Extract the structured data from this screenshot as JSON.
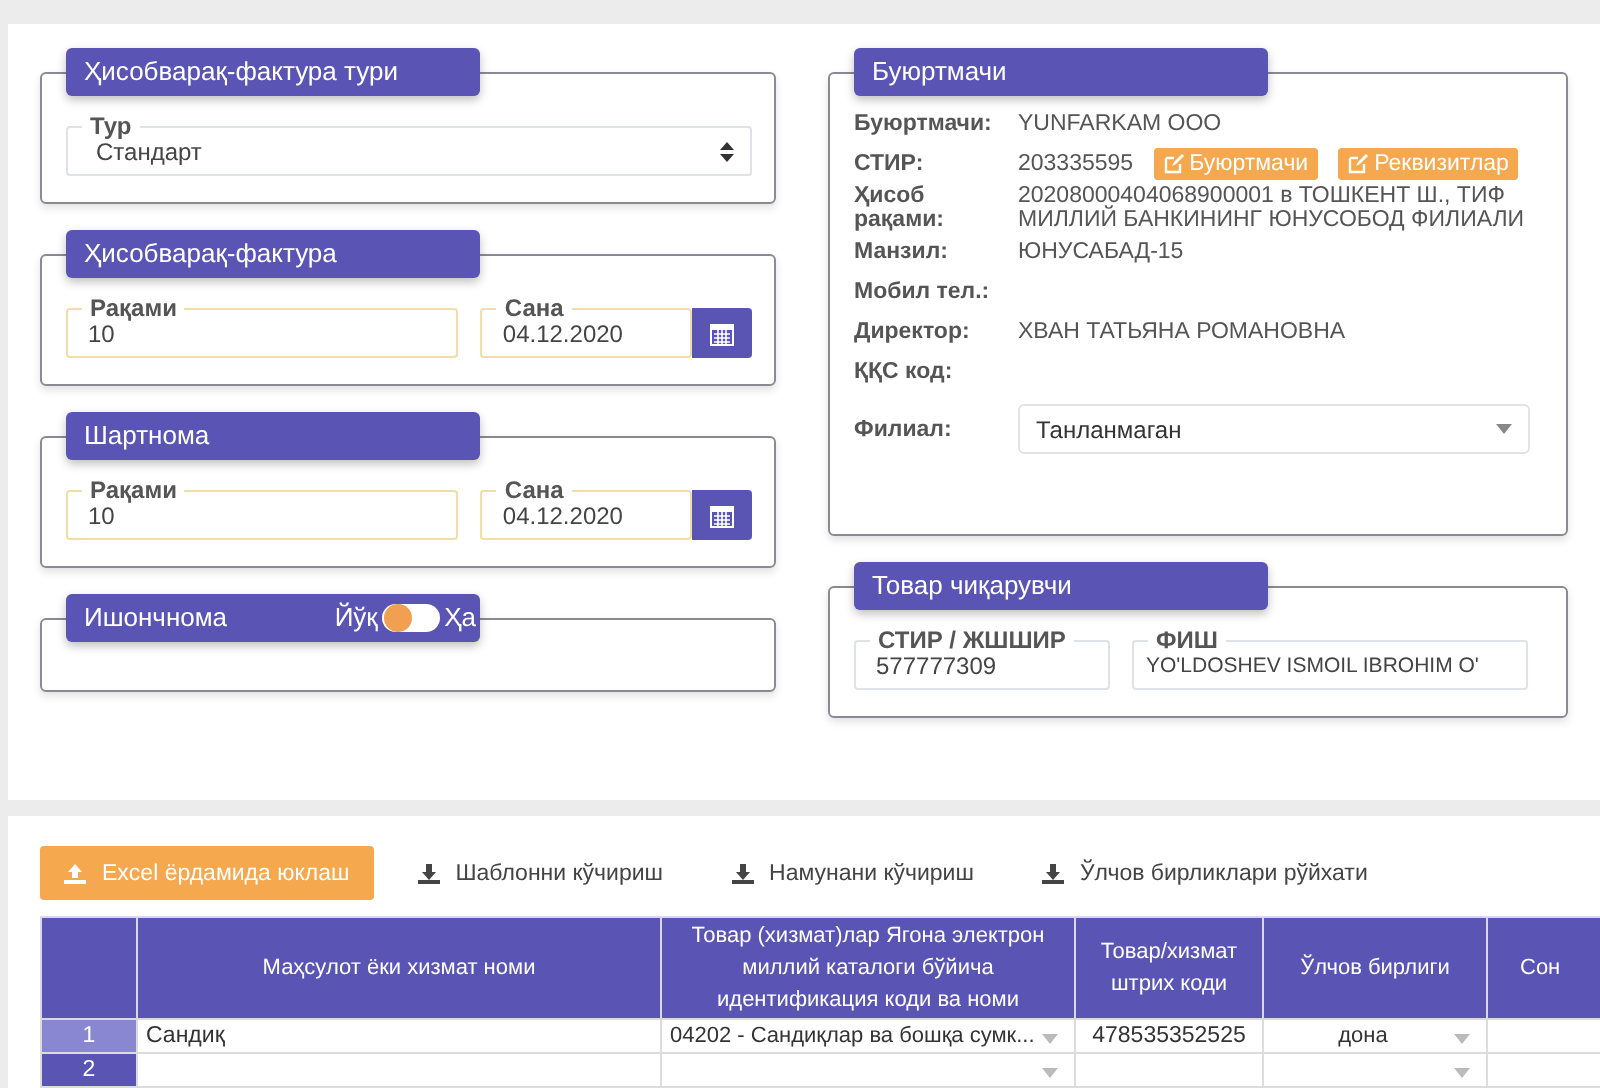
{
  "invoice_type": {
    "title": "Ҳисобварақ-фактура тури",
    "field": {
      "label": "Тур",
      "value": "Стандарт"
    }
  },
  "invoice": {
    "title": "Ҳисобварақ-фактура",
    "number": {
      "label": "Рақами",
      "value": "10"
    },
    "date": {
      "label": "Сана",
      "value": "04.12.2020"
    }
  },
  "contract": {
    "title": "Шартнома",
    "number": {
      "label": "Рақами",
      "value": "10"
    },
    "date": {
      "label": "Сана",
      "value": "04.12.2020"
    }
  },
  "power_of_attorney": {
    "title": "Ишончнома",
    "off_label": "Йўқ",
    "on_label": "Ҳа",
    "on": false
  },
  "customer": {
    "title": "Буюртмачи",
    "rows": [
      {
        "label": "Буюртмачи:",
        "value": "YUNFARKAM OOO"
      },
      {
        "label": "СТИР:",
        "value": "203335595",
        "buttons": [
          "Буюртмачи",
          "Реквизитлар"
        ]
      },
      {
        "label": "Ҳисоб рақами:",
        "value": "20208000404068900001 в ТОШКЕНТ Ш., ТИФ МИЛЛИЙ БАНКИНИНГ ЮНУСОБОД ФИЛИАЛИ"
      },
      {
        "label": "Манзил:",
        "value": "ЮНУСАБАД-15"
      },
      {
        "label": "Мобил тел.:"
      },
      {
        "label": "Директор:",
        "value": "ХВАН ТАТЬЯНА РОМАНОВНА"
      },
      {
        "label": "ҚҚС код:"
      }
    ],
    "branch": {
      "label": "Филиал:",
      "value": "Танланмаган"
    }
  },
  "producer": {
    "title": "Товар чиқарувчи",
    "tin": {
      "label": "СТИР / ЖШШИР",
      "value": "577777309"
    },
    "name": {
      "label": "ФИШ",
      "value": "YO'LDOSHEV ISMOIL IBROHIM O'"
    }
  },
  "toolbar": [
    {
      "label": "Excel ёрдамида юклаш",
      "kind": "primary"
    },
    {
      "label": "Шаблонни кўчириш",
      "kind": "link"
    },
    {
      "label": "Намунани кўчириш",
      "kind": "link"
    },
    {
      "label": "Ўлчов бирликлари рўйхати",
      "kind": "link"
    }
  ],
  "table": {
    "columns": [
      "Маҳсулот ёки хизмат номи",
      "Товар (хизмат)лар Ягона электрон миллий каталоги бўйича идентификация коди ва номи",
      "Товар/хизмат штрих коди",
      "Ўлчов бирлиги",
      "Сон"
    ],
    "rows": [
      {
        "number": "1",
        "selected": true,
        "name": "Сандиқ",
        "code": "04202 - Сандиқлар ва бошқа сумк...",
        "barcode": "478535352525",
        "unit": "дона"
      },
      {
        "number": "2",
        "selected": false
      }
    ]
  }
}
